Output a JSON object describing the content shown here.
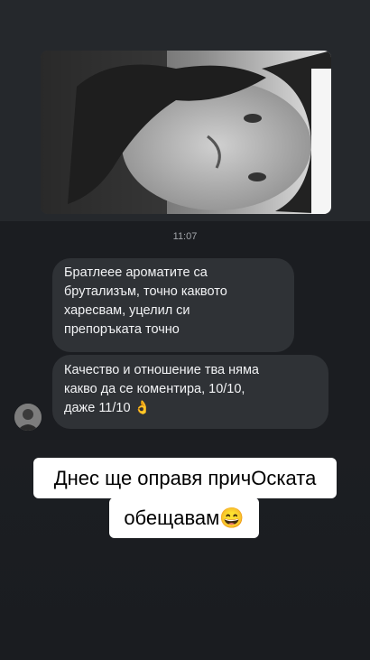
{
  "chat": {
    "timestamp": "11:07",
    "messages": [
      {
        "lines": [
          "Братлеее ароматите са",
          "брутализъм, точно каквото",
          "харесвам, уцелил си",
          "препоръката точно"
        ]
      },
      {
        "lines": [
          "Качество и отношение тва няма",
          "какво да се коментира, 10/10,",
          "даже 11/10 👌"
        ]
      }
    ]
  },
  "caption": {
    "line1": "Днес ще оправя причОската",
    "line2": "обещавам😄"
  },
  "colors": {
    "background": "#1b1d21",
    "bubble": "#2f3236",
    "caption_bg": "#ffffff"
  }
}
